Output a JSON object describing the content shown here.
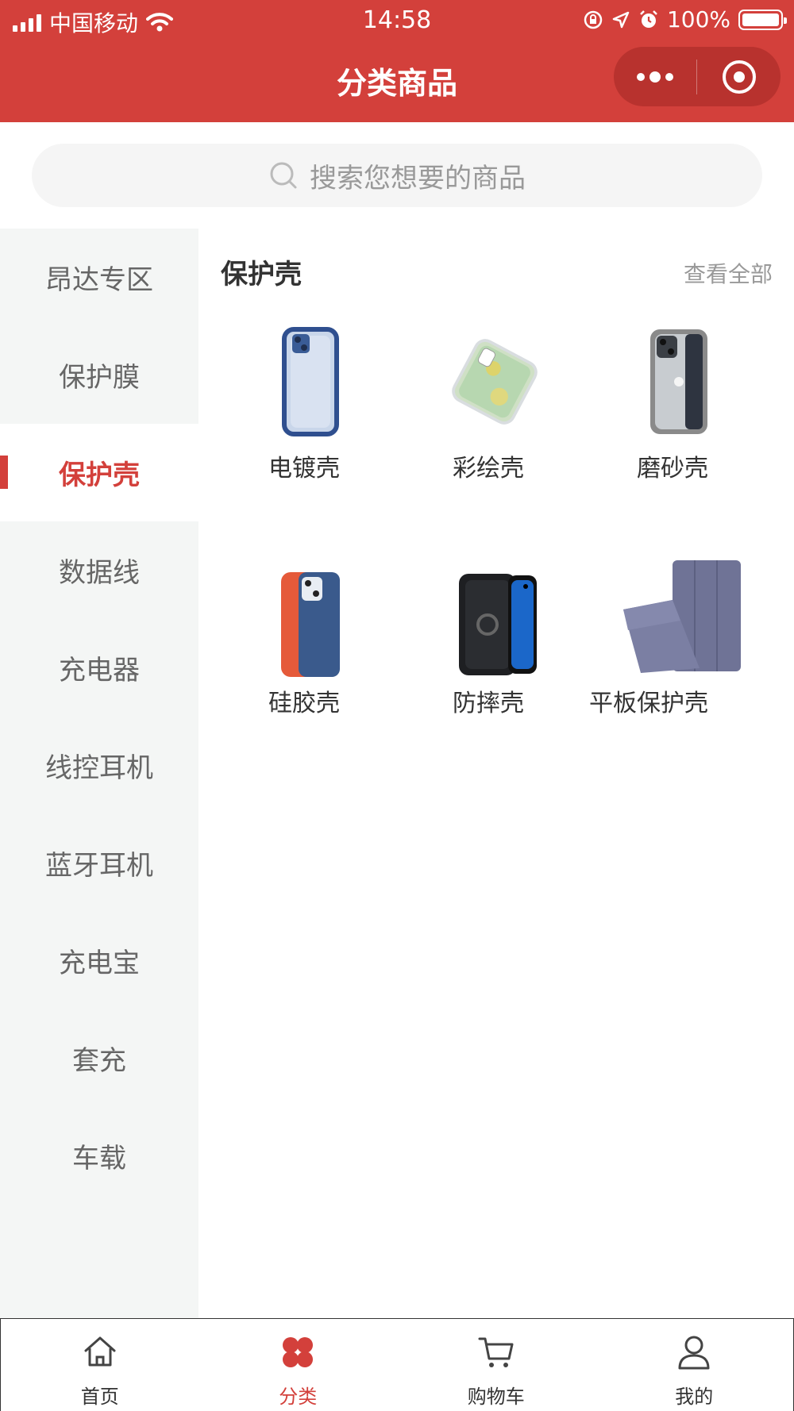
{
  "status_bar": {
    "carrier": "中国移动",
    "time": "14:58",
    "battery": "100%"
  },
  "nav": {
    "title": "分类商品"
  },
  "search": {
    "placeholder": "搜索您想要的商品"
  },
  "sidebar": {
    "items": [
      {
        "label": "昂达专区"
      },
      {
        "label": "保护膜"
      },
      {
        "label": "保护壳"
      },
      {
        "label": "数据线"
      },
      {
        "label": "充电器"
      },
      {
        "label": "线控耳机"
      },
      {
        "label": "蓝牙耳机"
      },
      {
        "label": "充电宝"
      },
      {
        "label": "套充"
      },
      {
        "label": "车载"
      }
    ],
    "active_index": 2
  },
  "section": {
    "title": "保护壳",
    "view_all": "查看全部",
    "products": [
      {
        "name": "电镀壳"
      },
      {
        "name": "彩绘壳"
      },
      {
        "name": "磨砂壳"
      },
      {
        "name": "硅胶壳"
      },
      {
        "name": "防摔壳"
      },
      {
        "name": "平板保护壳"
      }
    ]
  },
  "tabbar": {
    "items": [
      {
        "label": "首页",
        "icon": "home-icon"
      },
      {
        "label": "分类",
        "icon": "category-icon"
      },
      {
        "label": "购物车",
        "icon": "cart-icon"
      },
      {
        "label": "我的",
        "icon": "user-icon"
      }
    ],
    "active_index": 1
  },
  "colors": {
    "brand": "#d3403b",
    "sidebar_bg": "#f4f6f5"
  }
}
